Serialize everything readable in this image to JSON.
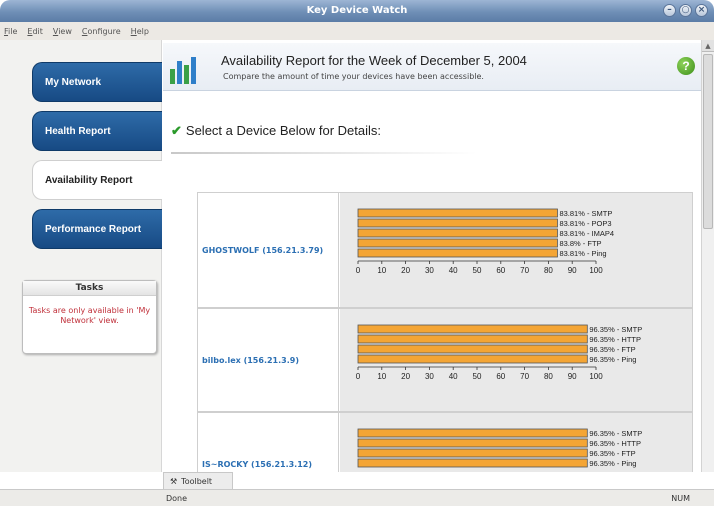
{
  "window": {
    "title": "Key Device Watch",
    "controls": [
      "–",
      "○",
      "×"
    ]
  },
  "menu": [
    "File",
    "Edit",
    "View",
    "Configure",
    "Help"
  ],
  "nav": [
    {
      "label": "My Network",
      "active": false
    },
    {
      "label": "Health Report",
      "active": false
    },
    {
      "label": "Availability Report",
      "active": true
    },
    {
      "label": "Performance Report",
      "active": false
    }
  ],
  "tasks": {
    "title": "Tasks",
    "message": "Tasks are only available in 'My Network' view."
  },
  "header": {
    "title": "Availability Report for the Week of December 5, 2004",
    "subtitle": "Compare the amount of time your devices have been accessible.",
    "help": "?"
  },
  "select_heading": "Select a Device Below for Details:",
  "devices": [
    {
      "name": "GHOSTWOLF (156.21.3.79)"
    },
    {
      "name": "bilbo.lex (156.21.3.9)"
    },
    {
      "name": "IS~ROCKY (156.21.3.12)"
    }
  ],
  "chart_data": [
    {
      "type": "bar",
      "categories": [
        "SMTP",
        "POP3",
        "IMAP4",
        "FTP",
        "Ping"
      ],
      "values": [
        83.81,
        83.81,
        83.81,
        83.8,
        83.81
      ],
      "labels": [
        "83.81% - SMTP",
        "83.81% - POP3",
        "83.81% - IMAP4",
        "83.8% - FTP",
        "83.81% - Ping"
      ],
      "xticks": [
        "0",
        "10",
        "20",
        "30",
        "40",
        "50",
        "60",
        "70",
        "80",
        "90",
        "100"
      ],
      "xlim": [
        0,
        100
      ],
      "color": "#f4a535"
    },
    {
      "type": "bar",
      "categories": [
        "SMTP",
        "HTTP",
        "FTP",
        "Ping"
      ],
      "values": [
        96.35,
        96.35,
        96.35,
        96.35
      ],
      "labels": [
        "96.35% - SMTP",
        "96.35% - HTTP",
        "96.35% - FTP",
        "96.35% - Ping"
      ],
      "xticks": [
        "0",
        "10",
        "20",
        "30",
        "40",
        "50",
        "60",
        "70",
        "80",
        "90",
        "100"
      ],
      "xlim": [
        0,
        100
      ],
      "color": "#f4a535"
    },
    {
      "type": "bar",
      "categories": [
        "SMTP",
        "HTTP",
        "FTP",
        "Ping"
      ],
      "values": [
        96.35,
        96.35,
        96.35,
        96.35
      ],
      "labels": [
        "96.35% - SMTP",
        "96.35% - HTTP",
        "96.35% - FTP",
        "96.35% - Ping"
      ],
      "xticks": [],
      "xlim": [
        0,
        100
      ],
      "color": "#f4a535"
    }
  ],
  "toolbelt": {
    "label": "Toolbelt"
  },
  "status": {
    "text": "Done",
    "num": "NUM"
  }
}
